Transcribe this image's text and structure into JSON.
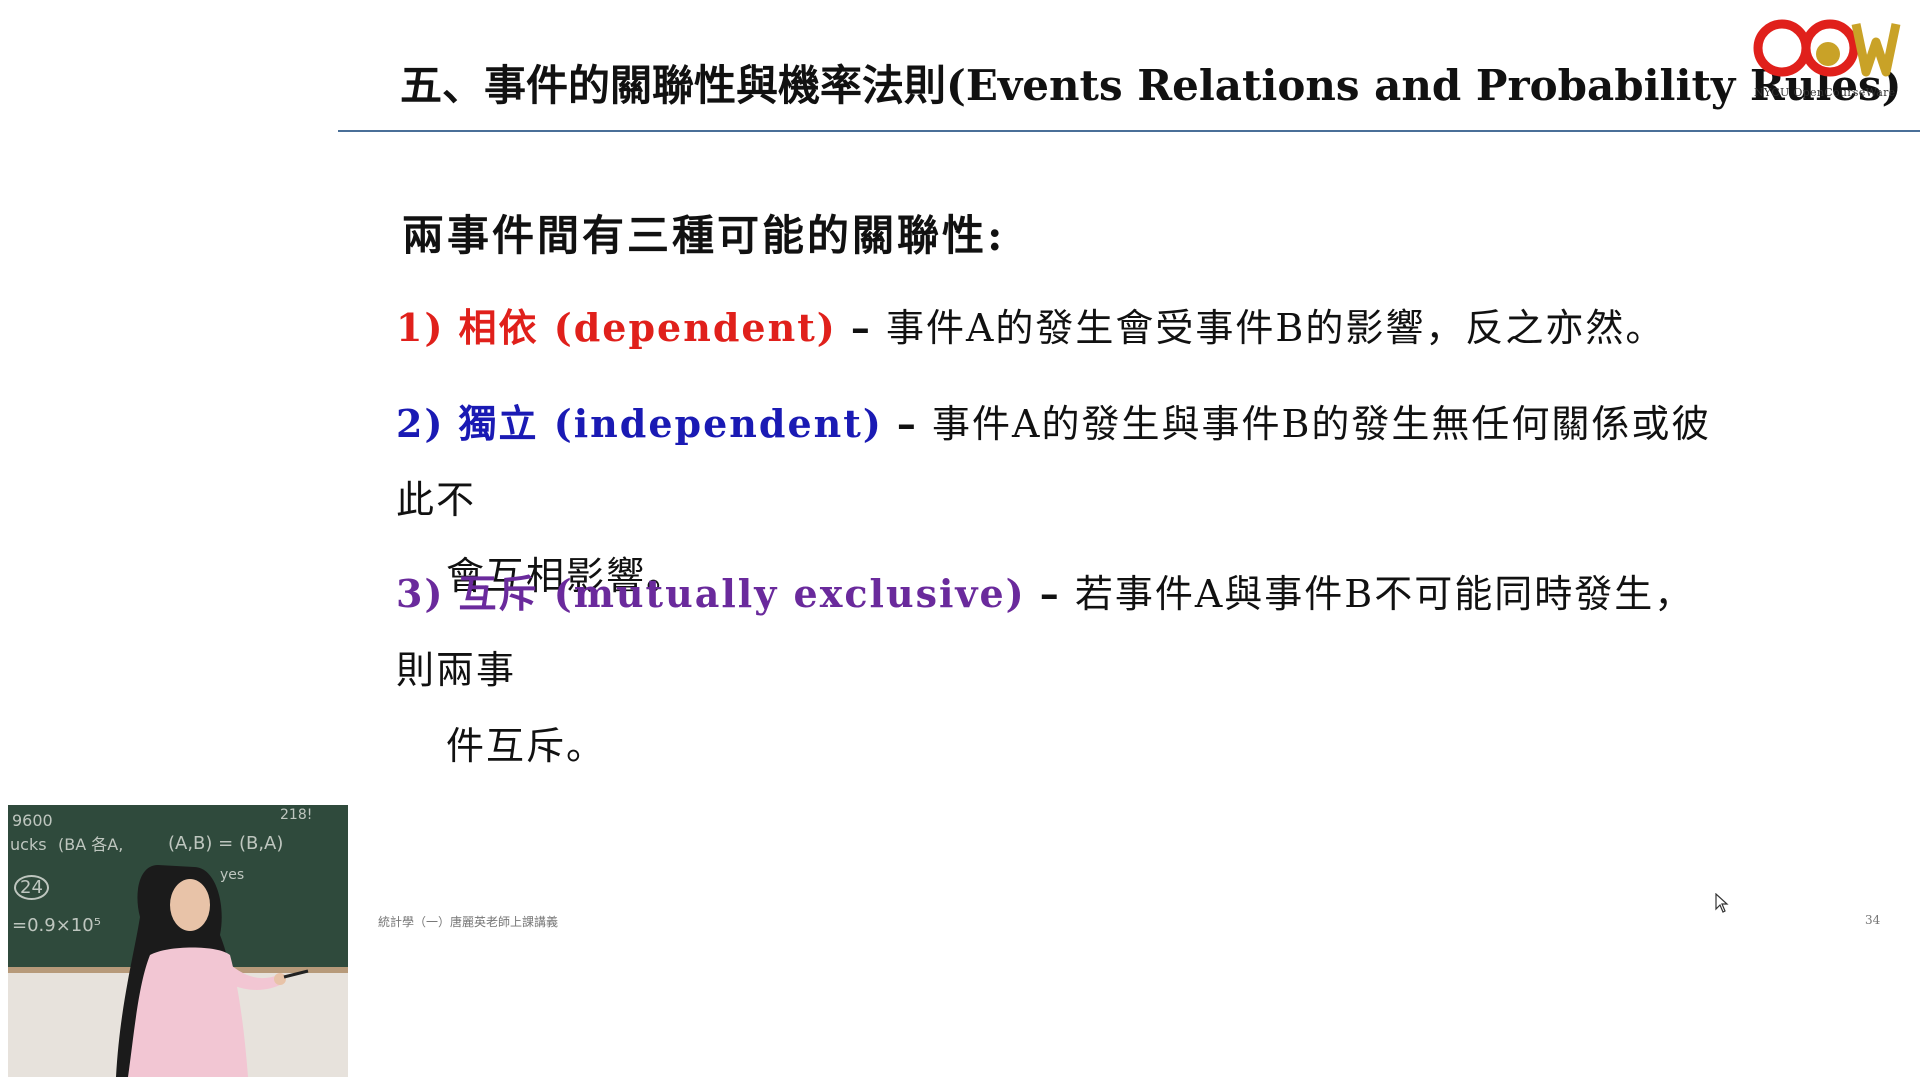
{
  "slide": {
    "title": "五、事件的關聯性與機率法則(Events Relations and Probability Rules)",
    "heading": "兩事件間有三種可能的關聯性:",
    "items": [
      {
        "number": "1)",
        "term": "相依 (dependent)",
        "dash": "–",
        "text": "事件A的發生會受事件B的影響，反之亦然。",
        "continuation": "",
        "color": "#e0201b"
      },
      {
        "number": "2)",
        "term": "獨立 (independent)",
        "dash": "–",
        "text": "事件A的發生與事件B的發生無任何關係或彼此不",
        "continuation": "會互相影響。",
        "color": "#1a1ab4"
      },
      {
        "number": "3)",
        "term": "互斥 (mutually exclusive)",
        "dash": "–",
        "text": "若事件A與事件B不可能同時發生，則兩事",
        "continuation": "件互斥。",
        "color": "#6a2a9c"
      }
    ],
    "footer_course": "統計學（一）唐麗英老師上課講義",
    "page_number": "34"
  },
  "logo": {
    "text": "OCW",
    "caption": "NYCU OpenCourseWare",
    "colors": {
      "red": "#e0201b",
      "gold": "#c9a227"
    }
  },
  "video": {
    "chalk_text": [
      "9600",
      "ucks",
      "(BA 各A,",
      "(A,B) = (B,A)",
      "218!",
      "24",
      "yes",
      "=0.9×10⁵"
    ]
  },
  "colors": {
    "title_rule": "#4a6f98",
    "dependent": "#e0201b",
    "independent": "#1a1ab4",
    "exclusive": "#6a2a9c"
  }
}
